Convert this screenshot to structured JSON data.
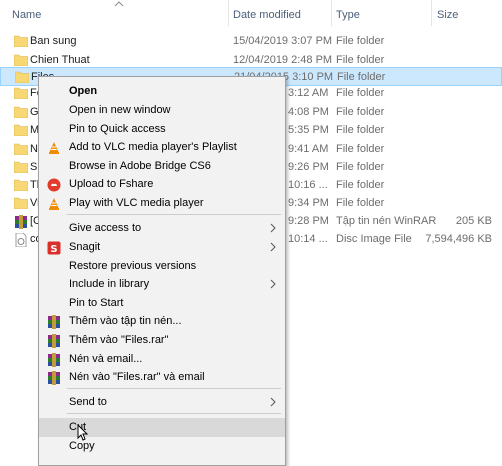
{
  "columns": {
    "name": "Name",
    "date": "Date modified",
    "type": "Type",
    "size": "Size"
  },
  "files": [
    {
      "name": "Ban sung",
      "date": "15/04/2019 3:07 PM",
      "type": "File folder",
      "size": "",
      "icon": "folder-icon"
    },
    {
      "name": "Chien Thuat",
      "date": "12/04/2019 2:48 PM",
      "type": "File folder",
      "size": "",
      "icon": "folder-icon"
    },
    {
      "name": "Files",
      "date": "21/04/2015 3:10 PM",
      "type": "File folder",
      "size": "",
      "icon": "folder-icon"
    },
    {
      "name": "Fo",
      "date": "3:12 AM",
      "type": "File folder",
      "size": "",
      "icon": "folder-icon"
    },
    {
      "name": "Ga",
      "date": "4:08 PM",
      "type": "File folder",
      "size": "",
      "icon": "folder-icon"
    },
    {
      "name": "M",
      "date": "5:35 PM",
      "type": "File folder",
      "size": "",
      "icon": "folder-icon"
    },
    {
      "name": "Nh",
      "date": "9:41 AM",
      "type": "File folder",
      "size": "",
      "icon": "folder-icon"
    },
    {
      "name": "Si",
      "date": "9:26 PM",
      "type": "File folder",
      "size": "",
      "icon": "folder-icon"
    },
    {
      "name": "Th",
      "date": "10:16 ...",
      "type": "File folder",
      "size": "",
      "icon": "folder-icon"
    },
    {
      "name": "Vi",
      "date": "9:34 PM",
      "type": "File folder",
      "size": "",
      "icon": "folder-icon"
    },
    {
      "name": "[C",
      "date": "9:28 PM",
      "type": "Tập tin nén WinRAR",
      "size": "205 KB",
      "icon": "winrar-icon"
    },
    {
      "name": "co",
      "date": "10:14 ...",
      "type": "Disc Image File",
      "size": "7,594,496 KB",
      "icon": "disc-file-icon"
    }
  ],
  "menu": [
    {
      "label": "Open",
      "bold": true,
      "icon": ""
    },
    {
      "label": "Open in new window",
      "icon": ""
    },
    {
      "label": "Pin to Quick access",
      "icon": ""
    },
    {
      "label": "Add to VLC media player's Playlist",
      "icon": "vlc-icon"
    },
    {
      "label": "Browse in Adobe Bridge CS6",
      "icon": ""
    },
    {
      "label": "Upload to Fshare",
      "icon": "fshare-icon"
    },
    {
      "label": "Play with VLC media player",
      "icon": "vlc-icon"
    },
    {
      "label": "Give access to",
      "submenu": true
    },
    {
      "label": "Snagit",
      "submenu": true,
      "icon": "snagit-icon"
    },
    {
      "label": "Restore previous versions"
    },
    {
      "label": "Include in library",
      "submenu": true
    },
    {
      "label": "Pin to Start"
    },
    {
      "label": "Thêm vào tập tin nén...",
      "icon": "winrar-icon"
    },
    {
      "label": "Thêm vào \"Files.rar\"",
      "icon": "winrar-icon"
    },
    {
      "label": "Nén và email...",
      "icon": "winrar-icon"
    },
    {
      "label": "Nén vào \"Files.rar\" và email",
      "icon": "winrar-icon"
    },
    {
      "label": "Send to",
      "submenu": true
    },
    {
      "label": "Cut"
    },
    {
      "label": "Copy"
    }
  ],
  "colors": {
    "selection": "#cce8ff",
    "folder": "#f8d775",
    "menu_bg": "#f2f2f2",
    "header_text": "#4c607a"
  }
}
